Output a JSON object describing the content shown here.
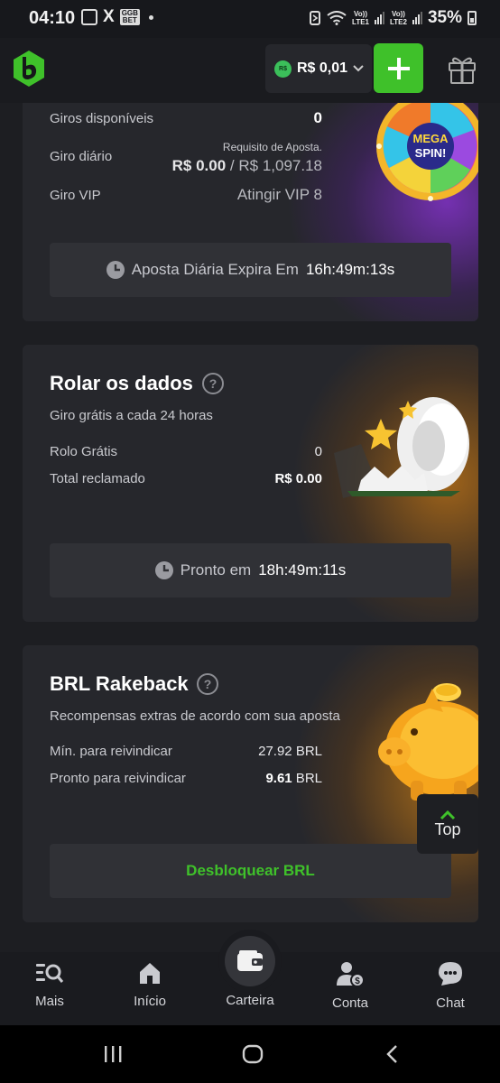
{
  "status_bar": {
    "time": "04:10",
    "ggb_badge_top": "GGB",
    "ggb_badge_bottom": "BET",
    "lte1": "LTE1",
    "lte2": "LTE2",
    "vo1": "Vo))",
    "vo2": "Vo))",
    "battery": "35%"
  },
  "header": {
    "coin_label": "R$",
    "balance": "R$ 0,01",
    "deposit_icon": "plus-icon",
    "gift_icon": "gift-icon",
    "brand_color": "#3fc12a"
  },
  "spin_card": {
    "rows": [
      {
        "label": "Giros disponíveis",
        "value": "0"
      },
      {
        "label": "Giro diário",
        "req_caption": "Requisito de Aposta.",
        "value_current": "R$ 0.00",
        "value_sep": " / ",
        "value_target": "R$ 1,097.18"
      },
      {
        "label": "Giro VIP",
        "value": "Atingir VIP 8"
      }
    ],
    "timer_label": "Aposta Diária Expira Em",
    "timer_value": "16h:49m:13s",
    "wheel_text_1": "MEGA",
    "wheel_text_2": "SPIN!"
  },
  "dice_card": {
    "title": "Rolar os dados",
    "subtitle": "Giro grátis a cada 24 horas",
    "rows": [
      {
        "label": "Rolo Grátis",
        "value": "0"
      },
      {
        "label": "Total reclamado",
        "value": "R$ 0.00"
      }
    ],
    "timer_label": "Pronto em",
    "timer_value": "18h:49m:11s"
  },
  "rakeback_card": {
    "title": "BRL Rakeback",
    "subtitle": "Recompensas extras de acordo com sua aposta",
    "rows": [
      {
        "label": "Mín. para reivindicar",
        "value": "27.92 BRL"
      },
      {
        "label": "Pronto para reivindicar",
        "value_strong": "9.61",
        "value_unit": " BRL"
      }
    ],
    "unlock_label": "Desbloquear BRL"
  },
  "top_button": {
    "label": "Top"
  },
  "bottom_nav": [
    {
      "label": "Mais",
      "icon": "menu-search-icon"
    },
    {
      "label": "Início",
      "icon": "home-icon"
    },
    {
      "label": "Carteira",
      "icon": "wallet-icon"
    },
    {
      "label": "Conta",
      "icon": "account-icon"
    },
    {
      "label": "Chat",
      "icon": "chat-icon"
    }
  ]
}
